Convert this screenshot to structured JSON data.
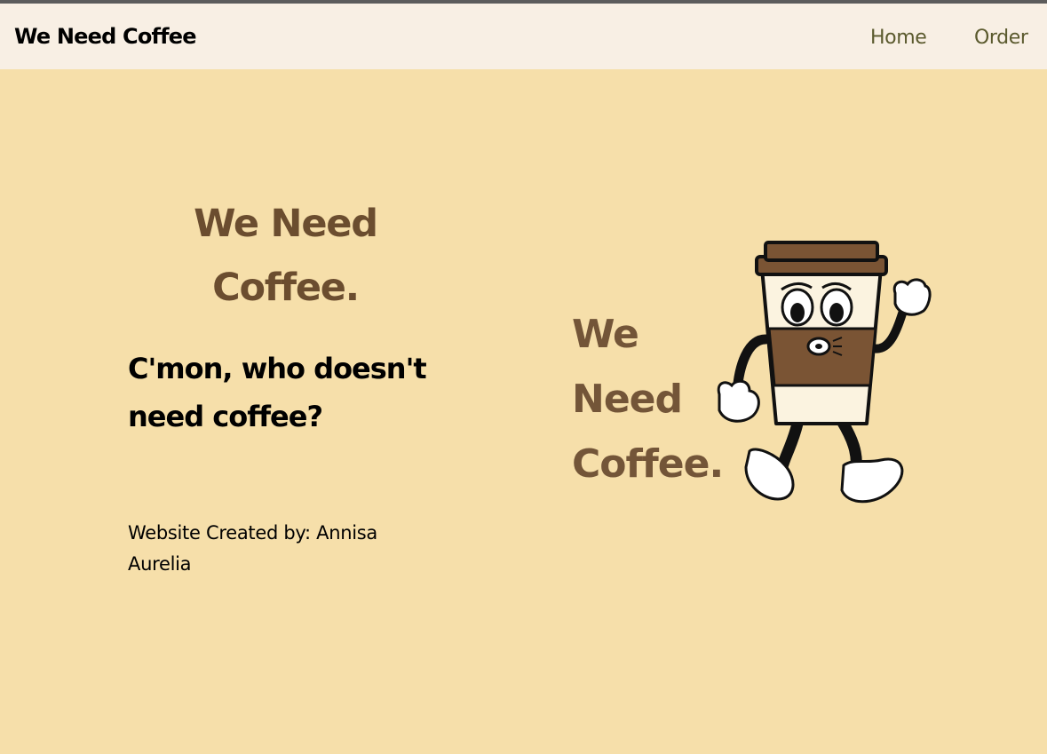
{
  "navbar": {
    "brand": "We Need Coffee",
    "links": [
      "Home",
      "Order"
    ]
  },
  "hero": {
    "title": "We Need Coffee.",
    "subtitle": "C'mon, who doesn't need coffee?",
    "credit": "Website Created by: Annisa Aurelia"
  },
  "illustration": {
    "icon": "walking-coffee-cup-mascot",
    "logo_text": "We Need Coffee."
  },
  "colors": {
    "page_background": "#f6dfaa",
    "navbar_background": "#f8efe4",
    "title_brown": "#6b4d2f",
    "nav_link": "#5b5a2e"
  }
}
